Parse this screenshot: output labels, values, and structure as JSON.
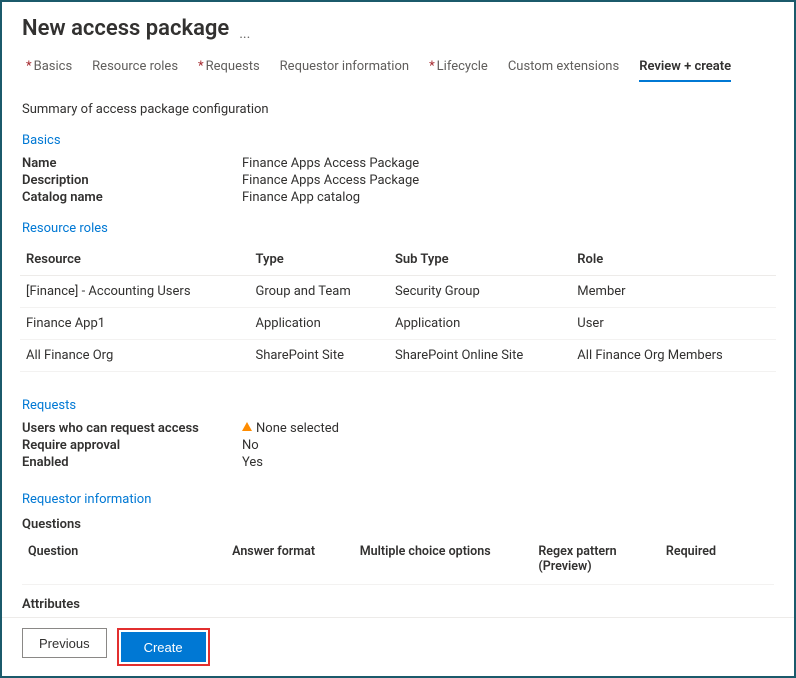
{
  "header": {
    "title": "New access package",
    "ellipsis": "···"
  },
  "tabs": {
    "basics": "Basics",
    "resource_roles": "Resource roles",
    "requests": "Requests",
    "requestor_info": "Requestor information",
    "lifecycle": "Lifecycle",
    "custom_ext": "Custom extensions",
    "review": "Review + create"
  },
  "summary_line": "Summary of access package configuration",
  "basics_section": {
    "heading": "Basics",
    "name_label": "Name",
    "name_value": "Finance Apps Access Package",
    "desc_label": "Description",
    "desc_value": "Finance Apps Access Package",
    "catalog_label": "Catalog name",
    "catalog_value": "Finance App catalog"
  },
  "roles_section": {
    "heading": "Resource roles",
    "cols": {
      "resource": "Resource",
      "type": "Type",
      "subtype": "Sub Type",
      "role": "Role"
    },
    "rows": [
      {
        "resource": "[Finance] - Accounting Users",
        "type": "Group and Team",
        "subtype": "Security Group",
        "role": "Member"
      },
      {
        "resource": "Finance App1",
        "type": "Application",
        "subtype": "Application",
        "role": "User"
      },
      {
        "resource": "All Finance Org",
        "type": "SharePoint Site",
        "subtype": "SharePoint Online Site",
        "role": "All Finance Org Members"
      }
    ]
  },
  "requests_section": {
    "heading": "Requests",
    "who_label": "Users who can request access",
    "who_value": "None selected",
    "approval_label": "Require approval",
    "approval_value": "No",
    "enabled_label": "Enabled",
    "enabled_value": "Yes"
  },
  "requestor_info_section": {
    "heading": "Requestor information",
    "questions_heading": "Questions",
    "cols": {
      "question": "Question",
      "answer_format": "Answer format",
      "mc_options": "Multiple choice options",
      "regex": "Regex pattern (Preview)",
      "required": "Required"
    },
    "attributes_heading": "Attributes"
  },
  "footer": {
    "previous": "Previous",
    "create": "Create"
  }
}
